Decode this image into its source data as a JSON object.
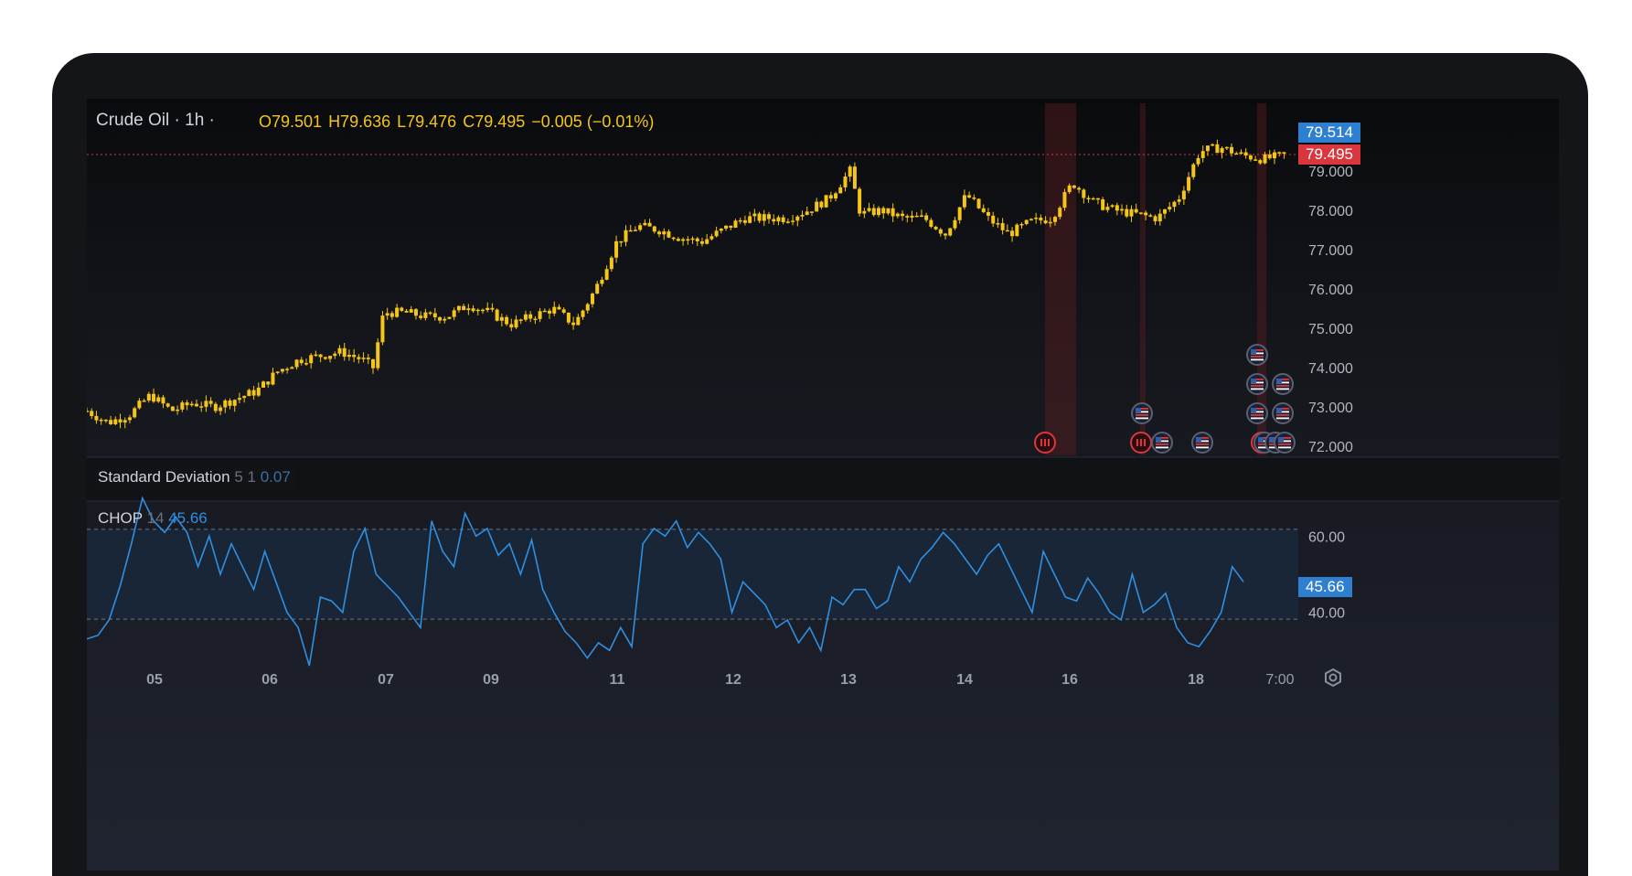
{
  "symbol": "Crude Oil · 1h ·",
  "ohlc": {
    "open": "O79.501",
    "high": "H79.636",
    "low": "L79.476",
    "close": "C79.495",
    "change": "−0.005 (−0.01%)"
  },
  "price_badges": {
    "current": "79.514",
    "last": "79.495"
  },
  "indicators": {
    "stddev": {
      "name": "Standard Deviation",
      "params": "5 1",
      "value": "0.07"
    },
    "chop": {
      "name": "CHOP",
      "params": "14",
      "value": "45.66",
      "badge": "45.66"
    }
  },
  "x_labels": [
    "05",
    "06",
    "07",
    "09",
    "11",
    "12",
    "13",
    "14",
    "16",
    "18",
    "7:00"
  ],
  "colors": {
    "candle": "#f5c518",
    "chop_line": "#2f8fe0",
    "badge_blue": "#2f7fd0",
    "badge_red": "#d9363e",
    "event_band": "#5a1c20"
  },
  "settings_icon": "gear-icon",
  "chart_data": [
    {
      "type": "candlestick",
      "title": "Crude Oil · 1h",
      "ylim": [
        72.0,
        79.6
      ],
      "y_ticks": [
        "79.000",
        "78.000",
        "77.000",
        "76.000",
        "75.000",
        "74.000",
        "73.000",
        "72.000"
      ],
      "x_ticks": [
        "05",
        "06",
        "07",
        "09",
        "11",
        "12",
        "13",
        "14",
        "16",
        "18",
        "7:00"
      ],
      "close_path": [
        [
          0,
          72.9
        ],
        [
          4,
          72.6
        ],
        [
          8,
          72.8
        ],
        [
          12,
          73.3
        ],
        [
          16,
          72.9
        ],
        [
          20,
          73.1
        ],
        [
          24,
          73.0
        ],
        [
          28,
          73.2
        ],
        [
          32,
          73.4
        ],
        [
          36,
          73.9
        ],
        [
          40,
          74.2
        ],
        [
          44,
          74.3
        ],
        [
          48,
          74.4
        ],
        [
          52,
          74.2
        ],
        [
          54,
          74.0
        ],
        [
          56,
          75.4
        ],
        [
          60,
          75.4
        ],
        [
          64,
          75.3
        ],
        [
          68,
          75.3
        ],
        [
          72,
          75.6
        ],
        [
          76,
          75.4
        ],
        [
          80,
          75.1
        ],
        [
          84,
          75.3
        ],
        [
          88,
          75.5
        ],
        [
          92,
          75.1
        ],
        [
          96,
          76.0
        ],
        [
          100,
          77.2
        ],
        [
          104,
          77.6
        ],
        [
          108,
          77.5
        ],
        [
          112,
          77.3
        ],
        [
          116,
          77.2
        ],
        [
          120,
          77.5
        ],
        [
          124,
          77.8
        ],
        [
          128,
          77.8
        ],
        [
          132,
          77.8
        ],
        [
          136,
          78.0
        ],
        [
          140,
          78.3
        ],
        [
          144,
          79.0
        ],
        [
          146,
          77.9
        ],
        [
          150,
          78.0
        ],
        [
          154,
          77.8
        ],
        [
          158,
          77.8
        ],
        [
          162,
          77.4
        ],
        [
          166,
          78.4
        ],
        [
          170,
          77.8
        ],
        [
          174,
          77.4
        ],
        [
          178,
          77.7
        ],
        [
          182,
          77.8
        ],
        [
          186,
          78.7
        ],
        [
          190,
          78.2
        ],
        [
          194,
          78.0
        ],
        [
          198,
          77.9
        ],
        [
          202,
          77.8
        ],
        [
          206,
          78.3
        ],
        [
          210,
          79.5
        ],
        [
          214,
          79.6
        ],
        [
          218,
          79.4
        ],
        [
          222,
          79.3
        ],
        [
          226,
          79.4
        ]
      ],
      "event_flags": [
        "us-flag-icon",
        "us-flag-icon",
        "us-flag-icon",
        "us-flag-icon",
        "us-flag-icon",
        "us-flag-icon",
        "us-flag-icon",
        "us-flag-icon",
        "us-flag-icon",
        "us-flag-icon",
        "us-flag-icon"
      ],
      "event_markers": [
        "earnings-icon",
        "earnings-icon",
        "earnings-icon"
      ]
    },
    {
      "type": "line",
      "title": "CHOP 14",
      "ylim": [
        26,
        68
      ],
      "y_ticks": [
        "60.00",
        "40.00"
      ],
      "bands": [
        61.8,
        38.2
      ],
      "series": [
        {
          "name": "CHOP",
          "values": [
            33,
            34,
            38,
            47,
            58,
            70,
            64,
            61,
            65,
            61,
            52,
            60,
            50,
            58,
            52,
            46,
            56,
            48,
            40,
            36,
            26,
            44,
            43,
            40,
            56,
            62,
            50,
            47,
            44,
            40,
            36,
            64,
            56,
            52,
            66,
            60,
            62,
            55,
            58,
            50,
            59,
            46,
            40,
            35,
            32,
            28,
            32,
            30,
            36,
            31,
            58,
            62,
            60,
            64,
            57,
            61,
            58,
            54,
            40,
            48,
            45,
            42,
            36,
            38,
            32,
            36,
            30,
            44,
            42,
            46,
            46,
            41,
            43,
            52,
            48,
            54,
            57,
            61,
            58,
            54,
            50,
            55,
            58,
            52,
            46,
            40,
            56,
            50,
            44,
            43,
            49,
            45,
            40,
            38,
            50,
            40,
            42,
            45,
            36,
            32,
            31,
            35,
            40,
            52,
            48
          ]
        }
      ]
    }
  ]
}
